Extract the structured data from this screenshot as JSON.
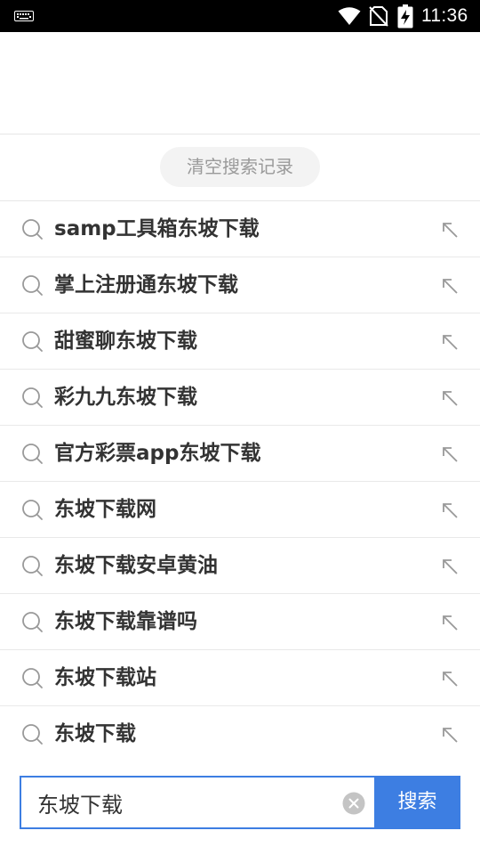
{
  "status_bar": {
    "time": "11:36",
    "icons": [
      "keyboard-icon",
      "wifi-icon",
      "no-sim-icon",
      "battery-charging-icon"
    ]
  },
  "clear_history": {
    "label": "清空搜索记录"
  },
  "history": [
    {
      "text": "samp工具箱东坡下载"
    },
    {
      "text": "掌上注册通东坡下载"
    },
    {
      "text": "甜蜜聊东坡下载"
    },
    {
      "text": "彩九九东坡下载"
    },
    {
      "text": "官方彩票app东坡下载"
    },
    {
      "text": "东坡下载网"
    },
    {
      "text": "东坡下载安卓黄油"
    },
    {
      "text": "东坡下载靠谱吗"
    },
    {
      "text": "东坡下载站"
    },
    {
      "text": "东坡下载"
    }
  ],
  "search": {
    "value": "东坡下载",
    "button_label": "搜索"
  },
  "colors": {
    "accent": "#3d7ee2",
    "text": "#333333",
    "muted": "#9a9a9a",
    "divider": "#e9e9e9"
  }
}
